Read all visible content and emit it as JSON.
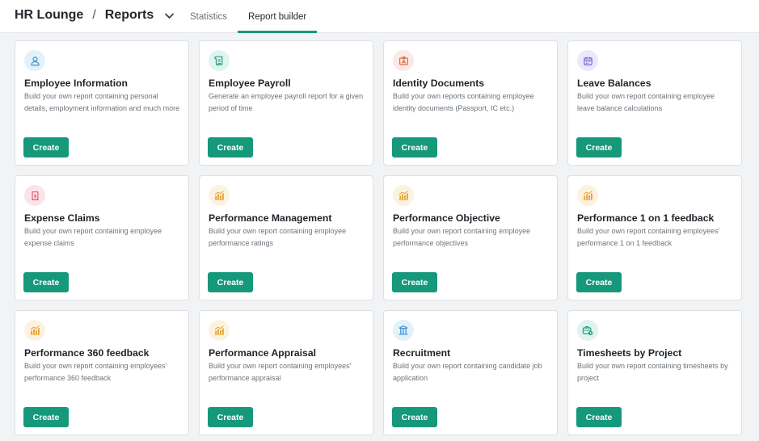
{
  "header": {
    "app_name": "HR Lounge",
    "separator": "/",
    "section": "Reports",
    "tabs": [
      {
        "label": "Statistics",
        "active": false
      },
      {
        "label": "Report builder",
        "active": true
      }
    ]
  },
  "colors": {
    "accent": "#16987a"
  },
  "cards": [
    {
      "title": "Employee Information",
      "description": "Build your own report containing personal details, employment information and much more",
      "button": "Create",
      "icon": "user-icon",
      "icon_bg": "#e3f1fb",
      "icon_color": "#3b8fd0"
    },
    {
      "title": "Employee Payroll",
      "description": "Generate an employee payroll report for a given period of time",
      "button": "Create",
      "icon": "scroll-icon",
      "icon_bg": "#dff4ee",
      "icon_color": "#2a9d7f"
    },
    {
      "title": "Identity Documents",
      "description": "Build your own reports containing employee identity documents (Passport, IC etc.)",
      "button": "Create",
      "icon": "id-badge-icon",
      "icon_bg": "#fbe9e4",
      "icon_color": "#d8643f"
    },
    {
      "title": "Leave Balances",
      "description": "Build your own report containing employee leave balance calculations",
      "button": "Create",
      "icon": "calendar-icon",
      "icon_bg": "#ebe8fb",
      "icon_color": "#6a5acd"
    },
    {
      "title": "Expense Claims",
      "description": "Build your own report containing employee expense claims",
      "button": "Create",
      "icon": "receipt-icon",
      "icon_bg": "#fbe4e8",
      "icon_color": "#d94a64"
    },
    {
      "title": "Performance Management",
      "description": "Build your own report containing employee performance ratings",
      "button": "Create",
      "icon": "bar-chart-icon",
      "icon_bg": "#fdf2e1",
      "icon_color": "#e0a030"
    },
    {
      "title": "Performance Objective",
      "description": "Build your own report containing employee performance objectives",
      "button": "Create",
      "icon": "bar-chart-icon",
      "icon_bg": "#fdf2e1",
      "icon_color": "#e0a030"
    },
    {
      "title": "Performance 1 on 1 feedback",
      "description": "Build your own report containing employees' performance 1 on 1 feedback",
      "button": "Create",
      "icon": "bar-chart-icon",
      "icon_bg": "#fdf2e1",
      "icon_color": "#e0a030"
    },
    {
      "title": "Performance 360 feedback",
      "description": "Build your own report containing employees' performance 360 feedback",
      "button": "Create",
      "icon": "bar-chart-icon",
      "icon_bg": "#fdf2e1",
      "icon_color": "#e0a030"
    },
    {
      "title": "Performance Appraisal",
      "description": "Build your own report containing employees' performance appraisal",
      "button": "Create",
      "icon": "bar-chart-icon",
      "icon_bg": "#fdf2e1",
      "icon_color": "#e0a030"
    },
    {
      "title": "Recruitment",
      "description": "Build your own report containing candidate job application",
      "button": "Create",
      "icon": "building-icon",
      "icon_bg": "#e3f1fb",
      "icon_color": "#3b8fd0"
    },
    {
      "title": "Timesheets by Project",
      "description": "Build your own report containing timesheets by project",
      "button": "Create",
      "icon": "briefcase-clock-icon",
      "icon_bg": "#dff4ee",
      "icon_color": "#2a9d7f"
    }
  ]
}
